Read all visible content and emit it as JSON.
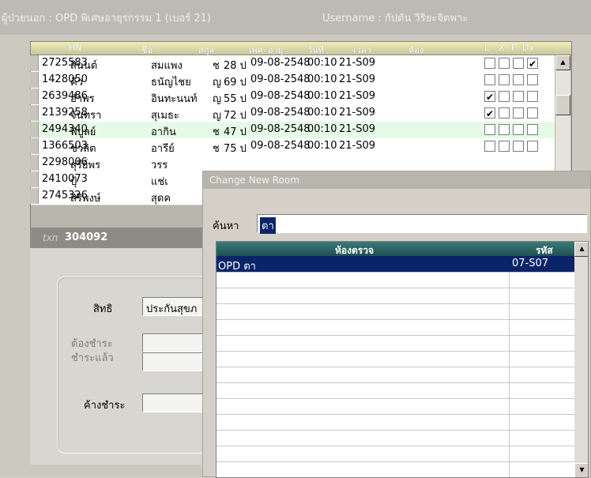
{
  "window": {
    "title": "ผู้ป่วยนอก : OPD พิเศษอายุรกรรม 1 (เบอร์ 21)",
    "username": "Username : กัปตัน  วิริยะจิตพาะ"
  },
  "table": {
    "columns": [
      "HN",
      "ชื่อ",
      "สกุล",
      "เพศ",
      "อายุ",
      "วันที่",
      "เวลา",
      "ห้อง",
      "L",
      "X",
      "F",
      "Dx"
    ],
    "rows": [
      {
        "hn": "2725583",
        "name": "สินนต์",
        "surname": "สมแพง",
        "sex": "ช",
        "age": "28 ป",
        "date": "09-08-2548",
        "time": "00:10",
        "room": "21-S09",
        "checks": [
          false,
          false,
          false,
          true
        ]
      },
      {
        "hn": "1428050",
        "name": "คิว",
        "surname": "ธนัญไชย",
        "sex": "ญ",
        "age": "69 ป",
        "date": "09-08-2548",
        "time": "00:10",
        "room": "21-S09",
        "checks": [
          false,
          false,
          false,
          false
        ]
      },
      {
        "hn": "2639486",
        "name": "อำพร",
        "surname": "อินทะนนท์",
        "sex": "ญ",
        "age": "55 ป",
        "date": "09-08-2548",
        "time": "00:10",
        "room": "21-S09",
        "checks": [
          true,
          false,
          false,
          false
        ]
      },
      {
        "hn": "2139258",
        "name": "จันทรา",
        "surname": "สุเมธะ",
        "sex": "ญ",
        "age": "72 ป",
        "date": "09-08-2548",
        "time": "00:10",
        "room": "21-S09",
        "checks": [
          true,
          false,
          false,
          false
        ]
      },
      {
        "hn": "2494340",
        "name": "พิบูลย์",
        "surname": "อากิน",
        "sex": "ช",
        "age": "47 ป",
        "date": "09-08-2548",
        "time": "00:10",
        "room": "21-S09",
        "checks": [
          false,
          false,
          false,
          false
        ]
      },
      {
        "hn": "1366503",
        "name": "ชวลิต",
        "surname": "อารีย์",
        "sex": "ช",
        "age": "75 ป",
        "date": "09-08-2548",
        "time": "00:10",
        "room": "21-S09",
        "checks": [
          false,
          false,
          false,
          false
        ]
      },
      {
        "hn": "2298006",
        "name": "สุรีย์พร",
        "surname": "วรร",
        "sex": "",
        "age": "",
        "date": "",
        "time": "",
        "room": "",
        "checks": []
      },
      {
        "hn": "2410073",
        "name": "ปุ้",
        "surname": "แช่เ",
        "sex": "",
        "age": "",
        "date": "",
        "time": "",
        "room": "",
        "checks": []
      },
      {
        "hn": "2745326",
        "name": "สิริพงษ์",
        "surname": "สุดค",
        "sex": "",
        "age": "",
        "date": "",
        "time": "",
        "room": "",
        "checks": []
      }
    ]
  },
  "patient_panel": {
    "txn_label": "txn",
    "txn_value": "304092",
    "right_label": "สิทธิ",
    "right_value": "ประกันสุขภ",
    "must_pay_label": "ต้องชำระ",
    "paid_label": "ชำระแล้ว",
    "outstanding_label": "ค้างชำระ"
  },
  "dialog": {
    "title": "Change New Room",
    "search_label": "ค้นหา",
    "search_value": "ตา",
    "columns": [
      "ห้องตรวจ",
      "รหัส"
    ],
    "rows": [
      {
        "room": "OPD ตา",
        "code": "07-S07"
      }
    ]
  },
  "colors": {
    "selected_row": "#e6fbe6",
    "dialog_selection": "#0a246a",
    "header_gradient": "#3c7a7a"
  }
}
